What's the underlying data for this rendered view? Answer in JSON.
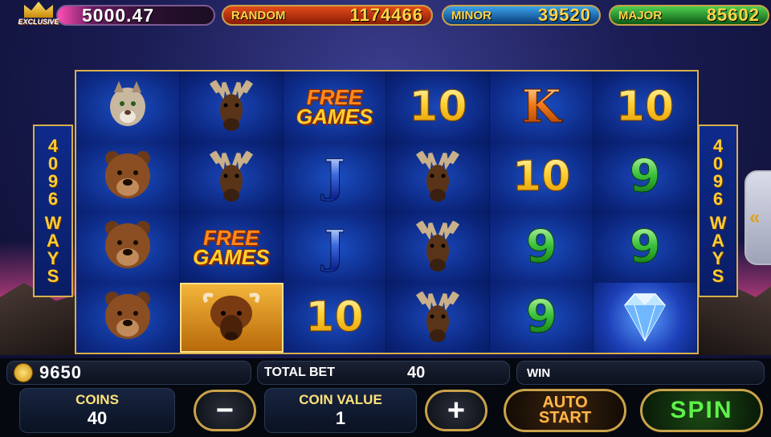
{
  "top_bar": {
    "badge_text": "EXCLUSIVE",
    "balance": "5000.47",
    "random": {
      "label": "RANDOM",
      "value": "1174466"
    },
    "minor": {
      "label": "MINOR",
      "value": "39520"
    },
    "major": {
      "label": "MAJOR",
      "value": "85602"
    }
  },
  "ways": {
    "number": [
      "4",
      "0",
      "9",
      "6"
    ],
    "word": [
      "W",
      "A",
      "Y",
      "S"
    ]
  },
  "reels": [
    [
      {
        "type": "animal",
        "name": "cougar"
      },
      {
        "type": "animal",
        "name": "moose"
      },
      {
        "type": "free",
        "line1": "FREE",
        "line2": "GAMES"
      },
      {
        "type": "num",
        "text": "10"
      },
      {
        "type": "K",
        "text": "K"
      },
      {
        "type": "num",
        "text": "10"
      }
    ],
    [
      {
        "type": "animal",
        "name": "bear"
      },
      {
        "type": "animal",
        "name": "moose"
      },
      {
        "type": "J",
        "text": "J"
      },
      {
        "type": "animal",
        "name": "moose"
      },
      {
        "type": "num",
        "text": "10"
      },
      {
        "type": "nine",
        "text": "9"
      }
    ],
    [
      {
        "type": "animal",
        "name": "bear"
      },
      {
        "type": "free",
        "line1": "FREE",
        "line2": "GAMES"
      },
      {
        "type": "J",
        "text": "J"
      },
      {
        "type": "animal",
        "name": "moose"
      },
      {
        "type": "nine",
        "text": "9"
      },
      {
        "type": "nine",
        "text": "9"
      }
    ],
    [
      {
        "type": "animal",
        "name": "bear"
      },
      {
        "type": "animal",
        "name": "buffalo"
      },
      {
        "type": "num",
        "text": "10"
      },
      {
        "type": "animal",
        "name": "moose"
      },
      {
        "type": "nine",
        "text": "9"
      },
      {
        "type": "animal",
        "name": "diamond"
      }
    ]
  ],
  "bottom": {
    "credit": "9650",
    "total_bet_label": "TOTAL BET",
    "total_bet": "40",
    "win_label": "WIN",
    "coins_label": "COINS",
    "coins": "40",
    "coin_value_label": "COIN VALUE",
    "coin_value": "1",
    "minus_label": "−",
    "plus_label": "+",
    "auto_line1": "AUTO",
    "auto_line2": "START",
    "spin_label": "SPIN",
    "side_tab_label": "«"
  }
}
